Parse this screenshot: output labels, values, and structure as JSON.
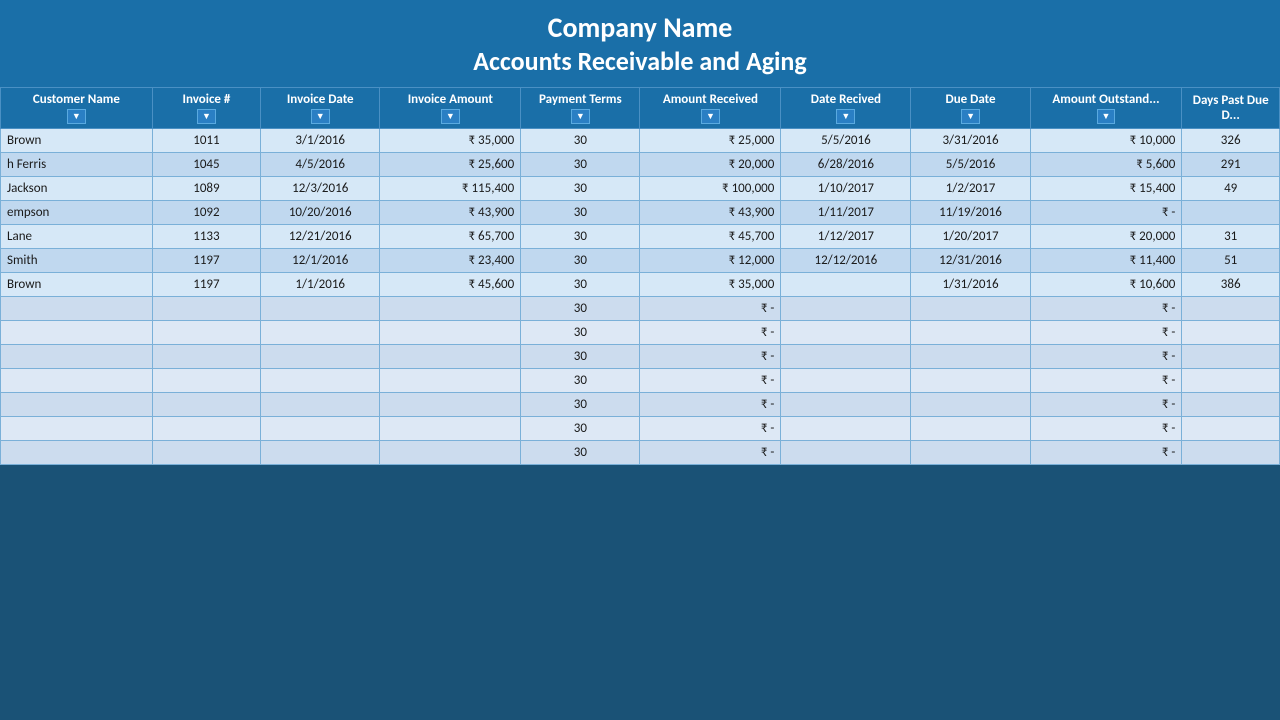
{
  "header": {
    "company_name": "Company Name",
    "report_title": "Accounts Receivable and Aging"
  },
  "columns": [
    {
      "id": "customer",
      "label": "Customer Name",
      "has_dropdown": true
    },
    {
      "id": "invoice_num",
      "label": "Invoice #",
      "has_dropdown": true
    },
    {
      "id": "invoice_date",
      "label": "Invoice Date",
      "has_dropdown": true
    },
    {
      "id": "invoice_amount",
      "label": "Invoice Amount",
      "has_dropdown": true
    },
    {
      "id": "payment_terms",
      "label": "Payment Terms",
      "has_dropdown": true
    },
    {
      "id": "amount_received",
      "label": "Amount Received",
      "has_dropdown": true
    },
    {
      "id": "date_received",
      "label": "Date Recived",
      "has_dropdown": true
    },
    {
      "id": "due_date",
      "label": "Due Date",
      "has_dropdown": true
    },
    {
      "id": "amount_outstanding",
      "label": "Amount Outstand...",
      "has_dropdown": true
    },
    {
      "id": "days_past_due",
      "label": "Days Past Due D...",
      "has_dropdown": false
    }
  ],
  "rows": [
    {
      "customer": "Brown",
      "invoice_num": "1011",
      "invoice_date": "3/1/2016",
      "invoice_amount": "₹  35,000",
      "payment_terms": "30",
      "amount_received": "₹  25,000",
      "date_received": "5/5/2016",
      "due_date": "3/31/2016",
      "amount_outstanding": "₹  10,000",
      "days_past_due": "326"
    },
    {
      "customer": "h Ferris",
      "invoice_num": "1045",
      "invoice_date": "4/5/2016",
      "invoice_amount": "₹  25,600",
      "payment_terms": "30",
      "amount_received": "₹  20,000",
      "date_received": "6/28/2016",
      "due_date": "5/5/2016",
      "amount_outstanding": "₹  5,600",
      "days_past_due": "291"
    },
    {
      "customer": "Jackson",
      "invoice_num": "1089",
      "invoice_date": "12/3/2016",
      "invoice_amount": "₹ 115,400",
      "payment_terms": "30",
      "amount_received": "₹ 100,000",
      "date_received": "1/10/2017",
      "due_date": "1/2/2017",
      "amount_outstanding": "₹  15,400",
      "days_past_due": "49"
    },
    {
      "customer": "empson",
      "invoice_num": "1092",
      "invoice_date": "10/20/2016",
      "invoice_amount": "₹  43,900",
      "payment_terms": "30",
      "amount_received": "₹  43,900",
      "date_received": "1/11/2017",
      "due_date": "11/19/2016",
      "amount_outstanding": "₹      -",
      "days_past_due": ""
    },
    {
      "customer": "Lane",
      "invoice_num": "1133",
      "invoice_date": "12/21/2016",
      "invoice_amount": "₹  65,700",
      "payment_terms": "30",
      "amount_received": "₹  45,700",
      "date_received": "1/12/2017",
      "due_date": "1/20/2017",
      "amount_outstanding": "₹  20,000",
      "days_past_due": "31"
    },
    {
      "customer": "Smith",
      "invoice_num": "1197",
      "invoice_date": "12/1/2016",
      "invoice_amount": "₹  23,400",
      "payment_terms": "30",
      "amount_received": "₹  12,000",
      "date_received": "12/12/2016",
      "due_date": "12/31/2016",
      "amount_outstanding": "₹  11,400",
      "days_past_due": "51"
    },
    {
      "customer": "Brown",
      "invoice_num": "1197",
      "invoice_date": "1/1/2016",
      "invoice_amount": "₹  45,600",
      "payment_terms": "30",
      "amount_received": "₹  35,000",
      "date_received": "",
      "due_date": "1/31/2016",
      "amount_outstanding": "₹  10,600",
      "days_past_due": "386"
    },
    {
      "customer": "",
      "invoice_num": "",
      "invoice_date": "",
      "invoice_amount": "",
      "payment_terms": "30",
      "amount_received": "₹       -",
      "date_received": "",
      "due_date": "",
      "amount_outstanding": "₹       -",
      "days_past_due": ""
    },
    {
      "customer": "",
      "invoice_num": "",
      "invoice_date": "",
      "invoice_amount": "",
      "payment_terms": "30",
      "amount_received": "₹       -",
      "date_received": "",
      "due_date": "",
      "amount_outstanding": "₹       -",
      "days_past_due": ""
    },
    {
      "customer": "",
      "invoice_num": "",
      "invoice_date": "",
      "invoice_amount": "",
      "payment_terms": "30",
      "amount_received": "₹       -",
      "date_received": "",
      "due_date": "",
      "amount_outstanding": "₹       -",
      "days_past_due": ""
    },
    {
      "customer": "",
      "invoice_num": "",
      "invoice_date": "",
      "invoice_amount": "",
      "payment_terms": "30",
      "amount_received": "₹       -",
      "date_received": "",
      "due_date": "",
      "amount_outstanding": "₹       -",
      "days_past_due": ""
    },
    {
      "customer": "",
      "invoice_num": "",
      "invoice_date": "",
      "invoice_amount": "",
      "payment_terms": "30",
      "amount_received": "₹       -",
      "date_received": "",
      "due_date": "",
      "amount_outstanding": "₹       -",
      "days_past_due": ""
    },
    {
      "customer": "",
      "invoice_num": "",
      "invoice_date": "",
      "invoice_amount": "",
      "payment_terms": "30",
      "amount_received": "₹       -",
      "date_received": "",
      "due_date": "",
      "amount_outstanding": "₹       -",
      "days_past_due": ""
    },
    {
      "customer": "",
      "invoice_num": "",
      "invoice_date": "",
      "invoice_amount": "",
      "payment_terms": "30",
      "amount_received": "₹       -",
      "date_received": "",
      "due_date": "",
      "amount_outstanding": "₹       -",
      "days_past_due": ""
    }
  ],
  "symbols": {
    "dropdown": "▼"
  }
}
